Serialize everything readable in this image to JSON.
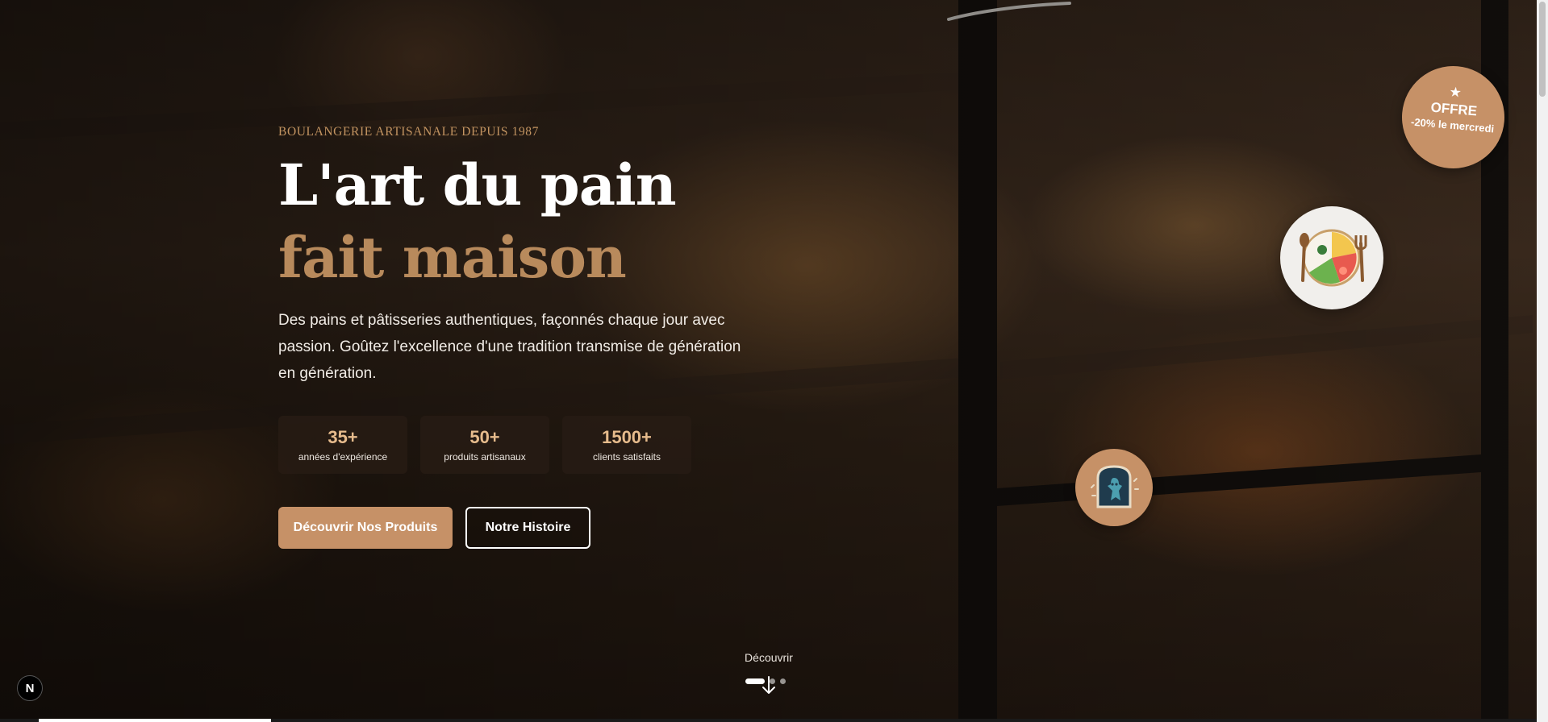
{
  "hero": {
    "kicker": "BOULANGERIE ARTISANALE DEPUIS 1987",
    "title_line1": "L'art du pain",
    "title_line2": "fait maison",
    "description": "Des pains et pâtisseries authentiques, façonnés chaque jour avec passion. Goûtez l'excellence d'une tradition transmise de génération en génération.",
    "stats": [
      {
        "value": "35+",
        "label": "années d'expérience"
      },
      {
        "value": "50+",
        "label": "produits artisanaux"
      },
      {
        "value": "1500+",
        "label": "clients satisfaits"
      }
    ],
    "buttons": {
      "primary": "Découvrir Nos Produits",
      "secondary": "Notre Histoire"
    }
  },
  "offer": {
    "icon": "star-icon",
    "title": "OFFRE",
    "subtitle": "-20% le mercredi"
  },
  "decor": {
    "plate_icon": "food-plate-icon",
    "toast_icon": "toast-icon"
  },
  "scroll": {
    "label": "Découvrir",
    "icon": "arrow-down-icon",
    "slides_total": 3,
    "active_slide": 1
  },
  "badge": {
    "label": "N"
  },
  "colors": {
    "accent": "#c69167",
    "accent_text": "#b88a5c",
    "stat_value": "#e6bb8c"
  }
}
